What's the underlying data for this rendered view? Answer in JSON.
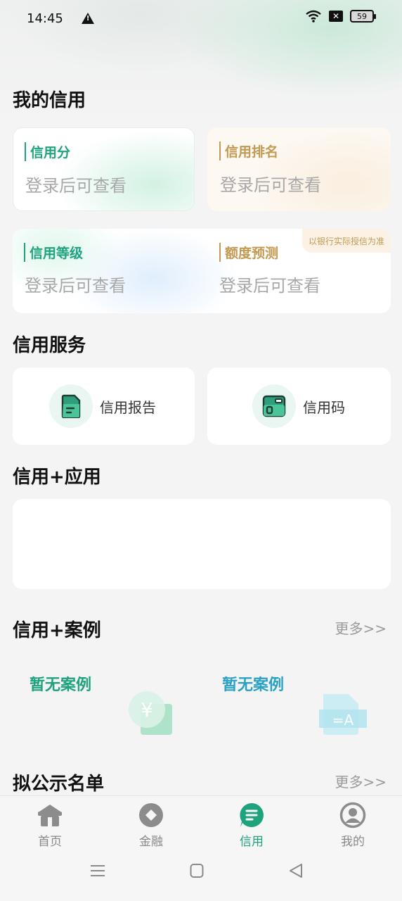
{
  "status": {
    "time": "14:45",
    "battery": "59"
  },
  "sections": {
    "my_credit": "我的信用",
    "services": "信用服务",
    "apps": "信用+应用",
    "cases": "信用+案例",
    "public_list": "拟公示名单"
  },
  "more_label": "更多>>",
  "credit_cards": {
    "score": {
      "label": "信用分",
      "value": "登录后可查看"
    },
    "rank": {
      "label": "信用排名",
      "value": "登录后可查看"
    },
    "level": {
      "label": "信用等级",
      "value": "登录后可查看"
    },
    "quota": {
      "label": "额度预测",
      "value": "登录后可查看",
      "note": "以银行实际授信为准"
    }
  },
  "services": [
    {
      "label": "信用报告",
      "icon": "document-icon"
    },
    {
      "label": "信用码",
      "icon": "credit-code-icon"
    }
  ],
  "cases": [
    {
      "title": "暂无案例",
      "icon": "yuan-coin-icon"
    },
    {
      "title": "暂无案例",
      "icon": "file-text-icon"
    }
  ],
  "tabs": [
    {
      "label": "首页",
      "icon": "home-icon"
    },
    {
      "label": "金融",
      "icon": "finance-icon"
    },
    {
      "label": "信用",
      "icon": "credit-icon",
      "active": true
    },
    {
      "label": "我的",
      "icon": "profile-icon"
    }
  ],
  "colors": {
    "accent": "#1fa37f",
    "gold": "#c29a52",
    "blue": "#2aa2c6"
  }
}
